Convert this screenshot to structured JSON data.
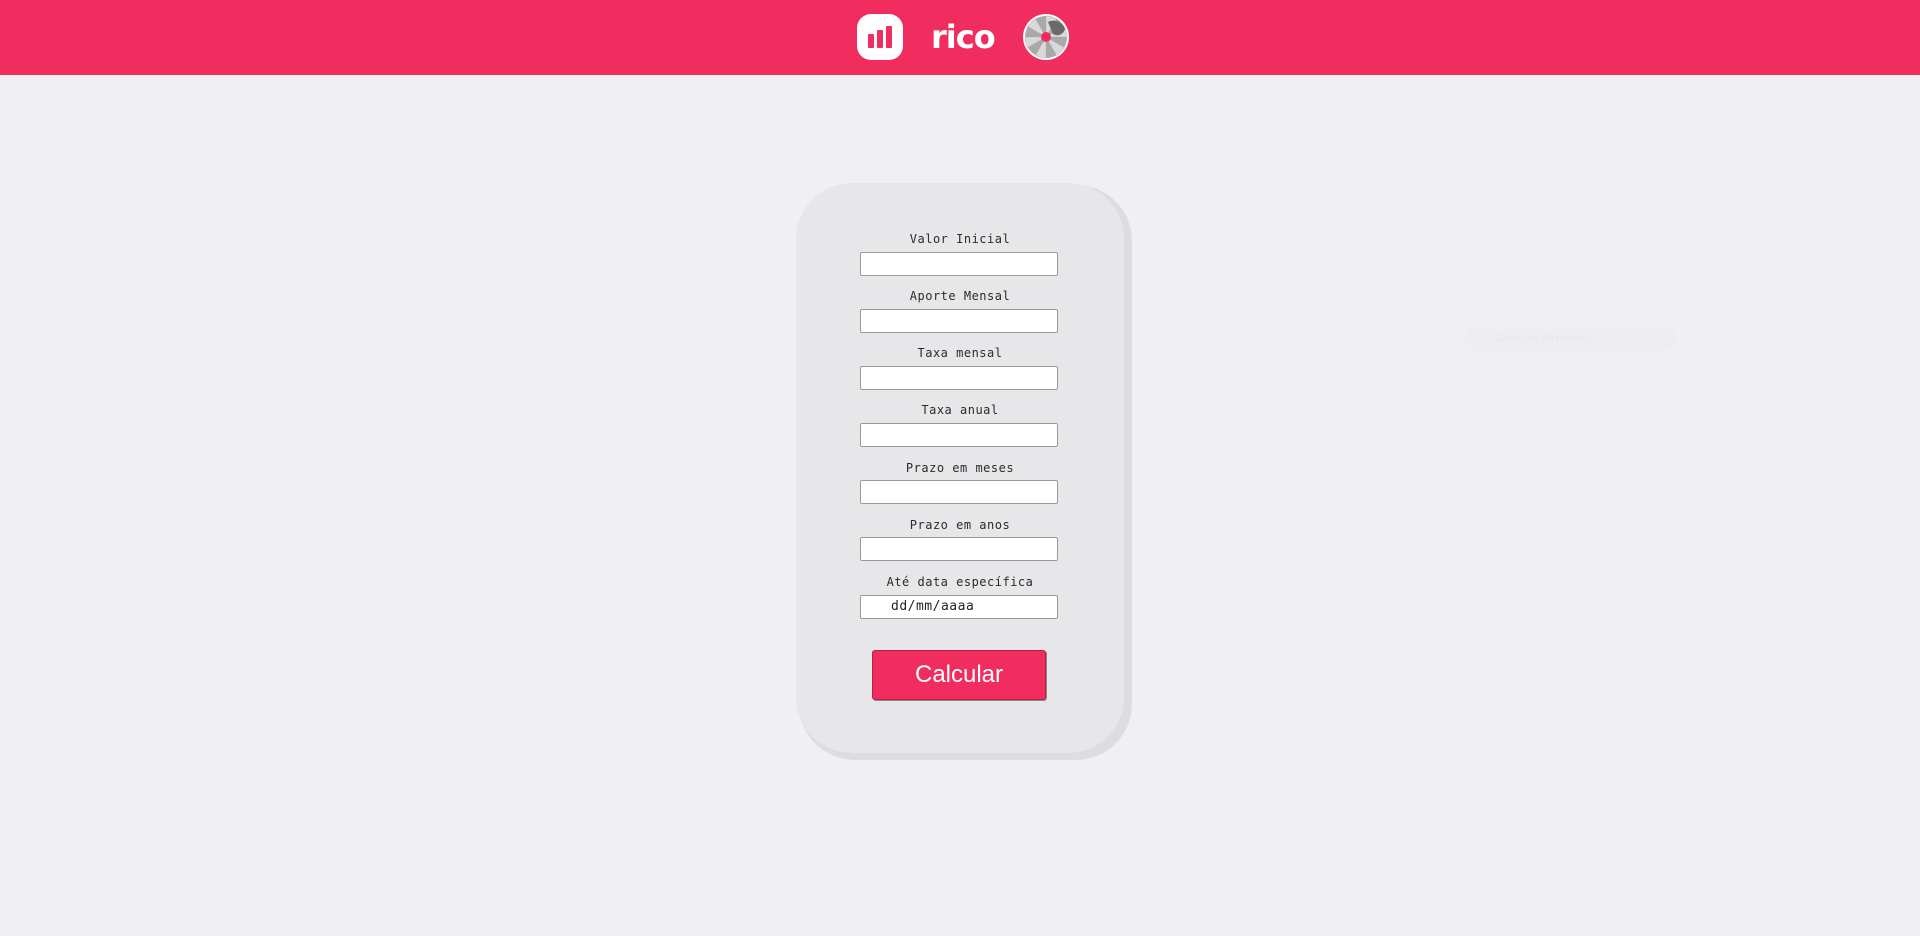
{
  "header": {
    "brand": "rico",
    "accent_color": "#f02d5e",
    "icons": [
      "bar-chart-app-icon",
      "pinwheel-icon"
    ]
  },
  "form": {
    "fields": [
      {
        "label": "Valor Inicial",
        "value": ""
      },
      {
        "label": "Aporte Mensal",
        "value": ""
      },
      {
        "label": "Taxa mensal",
        "value": ""
      },
      {
        "label": "Taxa anual",
        "value": ""
      },
      {
        "label": "Prazo em meses",
        "value": ""
      },
      {
        "label": "Prazo em anos",
        "value": ""
      },
      {
        "label": "Até data específica",
        "value": "dd/mm/aaaa"
      }
    ],
    "submit_label": "Calcular"
  },
  "faded_label": "Carregar do Arquivo"
}
